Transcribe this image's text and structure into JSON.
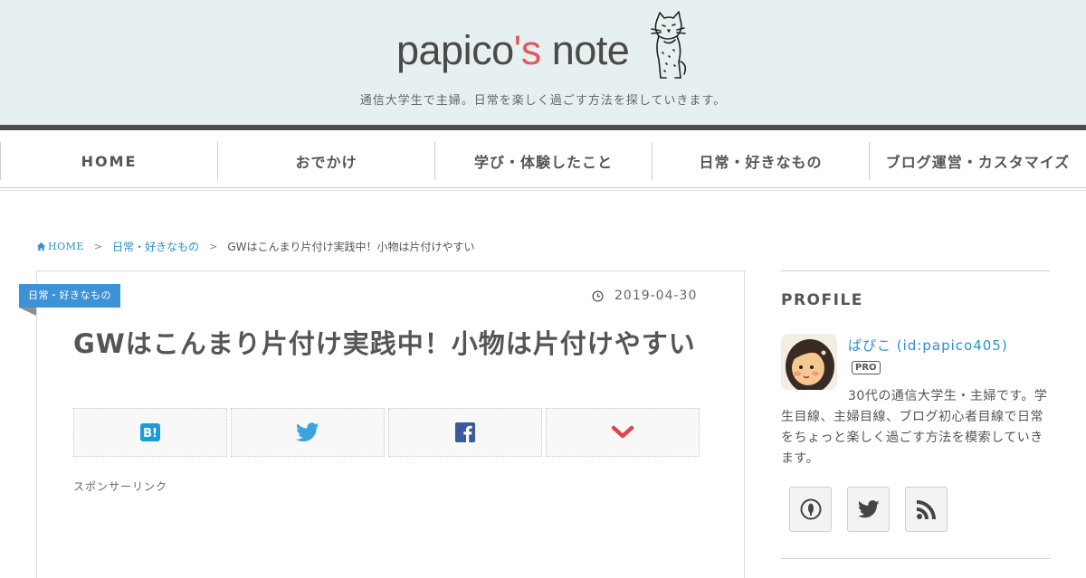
{
  "site": {
    "logo_main": "papico",
    "logo_accent": "'s",
    "logo_tail": " note",
    "tagline": "通信大学生で主婦。日常を楽しく過ごす方法を探していきます。"
  },
  "nav": {
    "items": [
      {
        "label": "HOME"
      },
      {
        "label": "おでかけ"
      },
      {
        "label": "学び・体験したこと"
      },
      {
        "label": "日常・好きなもの"
      },
      {
        "label": "ブログ運営・カスタマイズ"
      }
    ]
  },
  "breadcrumb": {
    "home": "HOME",
    "category": "日常・好きなもの",
    "current": "GWはこんまり片付け実践中！小物は片付けやすい"
  },
  "article": {
    "category": "日常・好きなもの",
    "date": "2019-04-30",
    "title": "GWはこんまり片付け実践中！小物は片付けやすい",
    "sponsor": "スポンサーリンク",
    "share_buttons": [
      "hatena-bookmark-icon",
      "twitter-icon",
      "facebook-icon",
      "pocket-icon"
    ]
  },
  "sidebar": {
    "profile_heading": "PROFILE",
    "name": "ぱぴこ (id:papico405)",
    "badge": "PRO",
    "bio": "30代の通信大学生・主婦です。学生目線、主婦目線、ブログ初心者目線で日常をちょっと楽しく過ごす方法を模索していきます。",
    "social_icons": [
      "hatena-icon",
      "twitter-icon",
      "rss-icon"
    ]
  },
  "colors": {
    "header_bg": "#e7f0f0",
    "accent_red": "#e05a5a",
    "link_blue": "#2f8fd0",
    "category_blue": "#3d92d6",
    "hatena_blue": "#1a9cdc",
    "twitter_blue": "#3ba4df",
    "facebook_blue": "#3b5a9a",
    "pocket_red": "#e24250"
  }
}
